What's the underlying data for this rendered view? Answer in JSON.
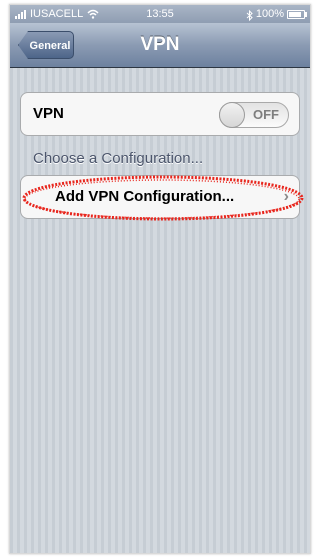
{
  "status_bar": {
    "carrier": "IUSACELL",
    "time": "13:55",
    "battery_text": "100%",
    "battery_level": 1.0
  },
  "nav": {
    "back_label": "General",
    "title": "VPN"
  },
  "vpn_toggle": {
    "label": "VPN",
    "state": "OFF"
  },
  "section": {
    "header": "Choose a Configuration..."
  },
  "add_config": {
    "label": "Add VPN Configuration..."
  },
  "annotation": {
    "color": "#e8261d"
  },
  "icons": {
    "signal": "signal-bars-icon",
    "wifi": "wifi-icon",
    "bluetooth": "bluetooth-icon",
    "battery": "battery-icon",
    "chevron": "chevron-right-icon"
  }
}
